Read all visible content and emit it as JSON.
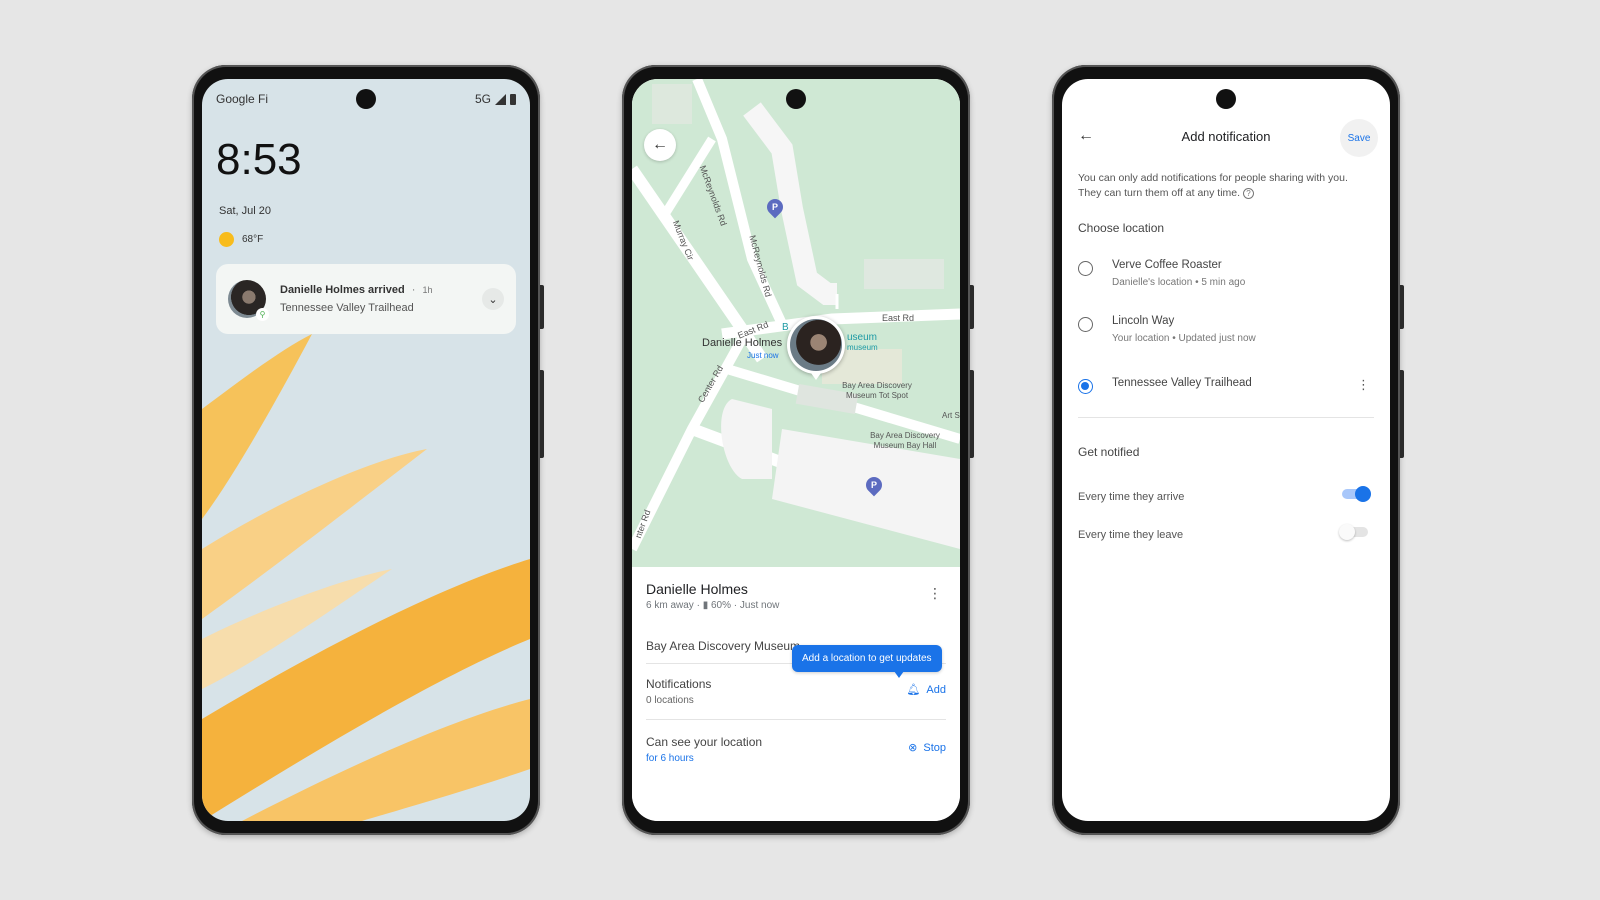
{
  "lock_screen": {
    "carrier": "Google Fi",
    "network": "5G",
    "time": "8:53",
    "date": "Sat, Jul 20",
    "temperature": "68°F",
    "notification": {
      "title": "Danielle Holmes arrived",
      "separator": "·",
      "time_ago": "1h",
      "subtitle": "Tennessee Valley Trailhead",
      "expand_icon": "chevron-down"
    }
  },
  "map_screen": {
    "back_icon": "←",
    "map_labels": {
      "road_mcreynolds_1": "McReynolds Rd",
      "road_mcreynolds_2": "McReynolds Rd",
      "road_murray": "Murray Cir",
      "road_east_1": "East Rd",
      "road_east_2": "East Rd",
      "road_center": "Center Rd",
      "road_center_2": "nter Rd",
      "museum_a": "B",
      "museum_b": "useum",
      "museum_c": "museum",
      "tot_spot": "Bay Area Discovery Museum Tot Spot",
      "bay_hall": "Bay Area Discovery Museum Bay Hall",
      "art": "Art S",
      "parking": "P"
    },
    "person": {
      "name": "Danielle Holmes",
      "status": "Just now"
    },
    "sheet": {
      "name": "Danielle Holmes",
      "distance": "6 km away",
      "battery": "60%",
      "updated": "Just now",
      "place": "Bay Area Discovery Museum",
      "tooltip": "Add a location to get updates",
      "notifications_title": "Notifications",
      "notifications_sub": "0 locations",
      "add_label": "Add",
      "sharing_title": "Can see your location",
      "sharing_sub": "for 6 hours",
      "stop_label": "Stop"
    }
  },
  "settings_screen": {
    "title": "Add notification",
    "save_label": "Save",
    "info": "You can only add notifications for people sharing with you. They can turn them off at any time.",
    "choose_location_title": "Choose location",
    "locations": [
      {
        "name": "Verve Coffee Roaster",
        "sub": "Danielle's location • 5 min ago",
        "selected": false
      },
      {
        "name": "Lincoln Way",
        "sub": "Your location • Updated just now",
        "selected": false
      },
      {
        "name": "Tennessee Valley Trailhead",
        "sub": "",
        "selected": true
      }
    ],
    "get_notified_title": "Get notified",
    "toggles": [
      {
        "label": "Every time they arrive",
        "on": true
      },
      {
        "label": "Every time they leave",
        "on": false
      }
    ]
  },
  "colors": {
    "accent": "#1a73e8",
    "map_green": "#cfe8d4",
    "wallpaper_orange": "#f6b441",
    "sun": "#f8bc1c",
    "parking": "#5c6bc0"
  }
}
